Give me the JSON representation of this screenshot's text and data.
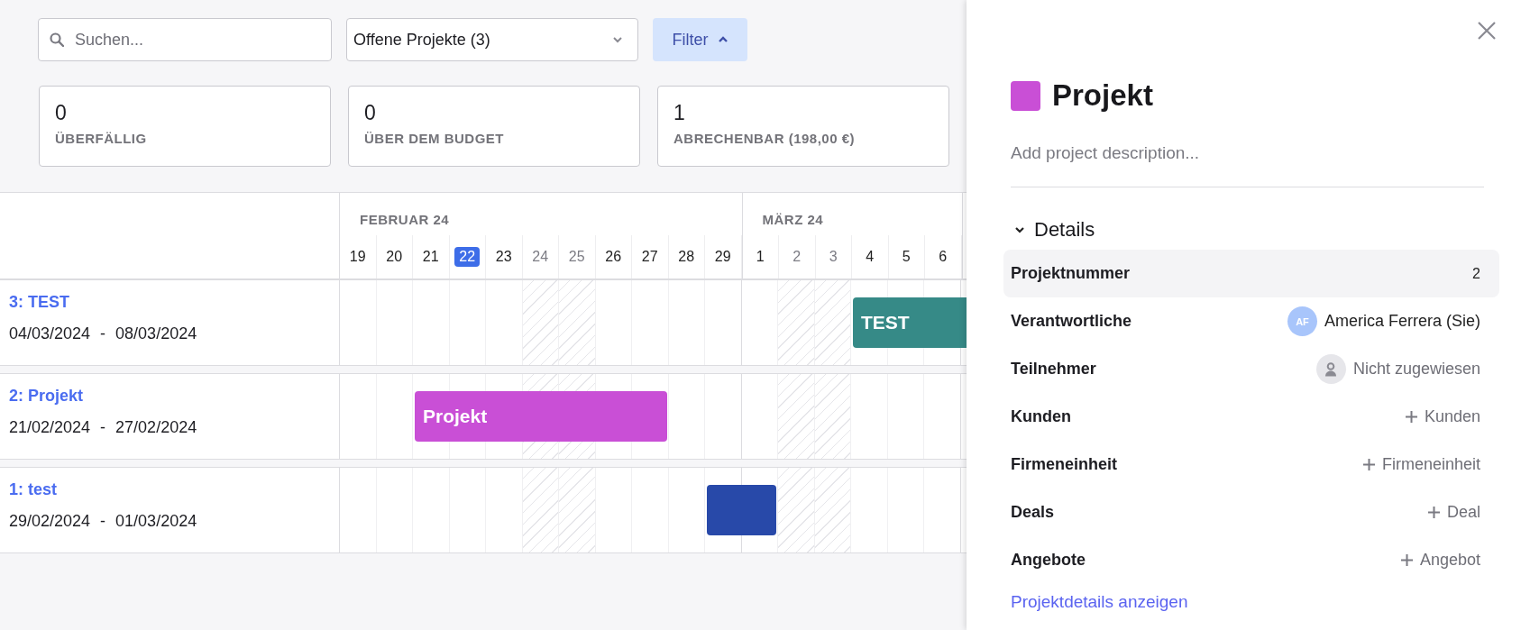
{
  "toolbar": {
    "search": {
      "placeholder": "Suchen..."
    },
    "view_select": {
      "value": "Offene Projekte (3)"
    },
    "filter_button": {
      "label": "Filter",
      "expanded": true
    }
  },
  "stats": [
    {
      "value": "0",
      "label": "ÜBERFÄLLIG"
    },
    {
      "value": "0",
      "label": "ÜBER DEM BUDGET"
    },
    {
      "value": "1",
      "label": "ABRECHENBAR (198,00 €)"
    }
  ],
  "timeline": {
    "months": [
      {
        "label": "FEBRUAR 24",
        "days": [
          {
            "day": "19",
            "weekend": false,
            "today": false
          },
          {
            "day": "20",
            "weekend": false,
            "today": false
          },
          {
            "day": "21",
            "weekend": false,
            "today": false
          },
          {
            "day": "22",
            "weekend": false,
            "today": true
          },
          {
            "day": "23",
            "weekend": false,
            "today": false
          },
          {
            "day": "24",
            "weekend": true,
            "today": false
          },
          {
            "day": "25",
            "weekend": true,
            "today": false
          },
          {
            "day": "26",
            "weekend": false,
            "today": false
          },
          {
            "day": "27",
            "weekend": false,
            "today": false
          },
          {
            "day": "28",
            "weekend": false,
            "today": false
          },
          {
            "day": "29",
            "weekend": false,
            "today": false
          }
        ]
      },
      {
        "label": "MÄRZ 24",
        "days": [
          {
            "day": "1",
            "weekend": false,
            "today": false
          },
          {
            "day": "2",
            "weekend": true,
            "today": false
          },
          {
            "day": "3",
            "weekend": true,
            "today": false
          },
          {
            "day": "4",
            "weekend": false,
            "today": false
          },
          {
            "day": "5",
            "weekend": false,
            "today": false
          },
          {
            "day": "6",
            "weekend": false,
            "today": false
          }
        ]
      }
    ]
  },
  "projects": [
    {
      "title": "3: TEST",
      "dates": "04/03/2024 - 08/03/2024",
      "bar_label": "TEST",
      "color": "#368a87"
    },
    {
      "title": "2: Projekt",
      "dates": "21/02/2024 - 27/02/2024",
      "bar_label": "Projekt",
      "color": "#c94fd6"
    },
    {
      "title": "1: test",
      "dates": "29/02/2024 - 01/03/2024",
      "color": "#2849a9"
    }
  ],
  "panel": {
    "title": "Projekt",
    "color": "#c94fd6",
    "description": {
      "placeholder": "Add project description..."
    },
    "details": {
      "label": "Details",
      "expanded": true,
      "rows": [
        {
          "label": "Projektnummer",
          "kind": "text",
          "value": "2",
          "highlighted": true
        },
        {
          "label": "Verantwortliche",
          "kind": "person",
          "initials": "AF",
          "value": "America Ferrera (Sie)",
          "highlighted": false
        },
        {
          "label": "Teilnehmer",
          "kind": "unassigned",
          "value": "Nicht zugewiesen",
          "highlighted": false
        },
        {
          "label": "Kunden",
          "kind": "add",
          "value": "Kunden",
          "highlighted": false
        },
        {
          "label": "Firmeneinheit",
          "kind": "add",
          "value": "Firmeneinheit",
          "highlighted": false
        },
        {
          "label": "Deals",
          "kind": "add",
          "value": "Deal",
          "highlighted": false
        },
        {
          "label": "Angebote",
          "kind": "add",
          "value": "Angebot",
          "highlighted": false
        }
      ]
    },
    "link": "Projektdetails anzeigen"
  }
}
